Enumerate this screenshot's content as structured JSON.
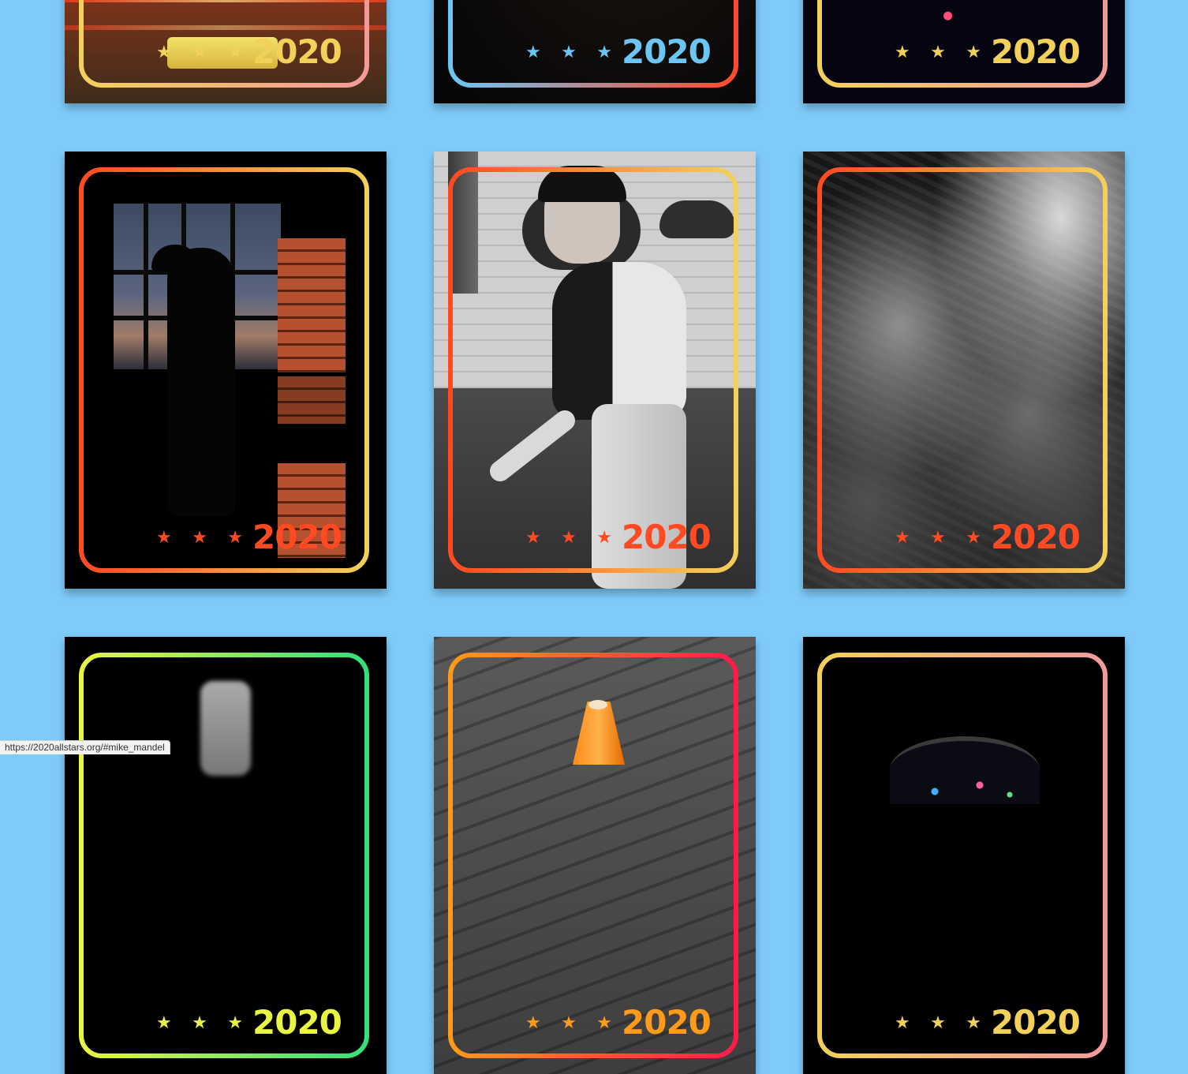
{
  "status_url": "https://2020allstars.org/#mike_mandel",
  "cards": [
    {
      "year": "2020",
      "star_color": "#f2d15a",
      "year_color": "#f2d15a",
      "frame": [
        "#f2d15a",
        "#f29a9a"
      ],
      "photo": "street"
    },
    {
      "year": "2020",
      "star_color": "#6cc6f5",
      "year_color": "#6cc6f5",
      "frame": [
        "#6cc6f5",
        "#ff4a2a"
      ],
      "photo": "dark"
    },
    {
      "year": "2020",
      "star_color": "#f2d15a",
      "year_color": "#f2d15a",
      "frame": [
        "#f2d15a",
        "#f29a9a"
      ],
      "photo": "floral"
    },
    {
      "year": "2020",
      "star_color": "#ff4a22",
      "year_color": "#ff4a22",
      "frame": [
        "#ff4a22",
        "#f2d15a"
      ],
      "photo": "window"
    },
    {
      "year": "2020",
      "star_color": "#ff4a22",
      "year_color": "#ff4a22",
      "frame": [
        "#ff4a22",
        "#f2d15a"
      ],
      "photo": "pitcher"
    },
    {
      "year": "2020",
      "star_color": "#ff4a22",
      "year_color": "#ff4a22",
      "frame": [
        "#ff4a22",
        "#f2d15a"
      ],
      "photo": "rock"
    },
    {
      "year": "2020",
      "star_color": "#e8f542",
      "year_color": "#e8f542",
      "frame": [
        "#e8f542",
        "#33e07a"
      ],
      "photo": "blur"
    },
    {
      "year": "2020",
      "star_color": "#ff9a1a",
      "year_color": "#ff9a1a",
      "frame": [
        "#ff9a1a",
        "#ff1a4a"
      ],
      "photo": "cone"
    },
    {
      "year": "2020",
      "star_color": "#f2d15a",
      "year_color": "#f2d15a",
      "frame": [
        "#f2d15a",
        "#f29a9a"
      ],
      "photo": "plate"
    }
  ]
}
